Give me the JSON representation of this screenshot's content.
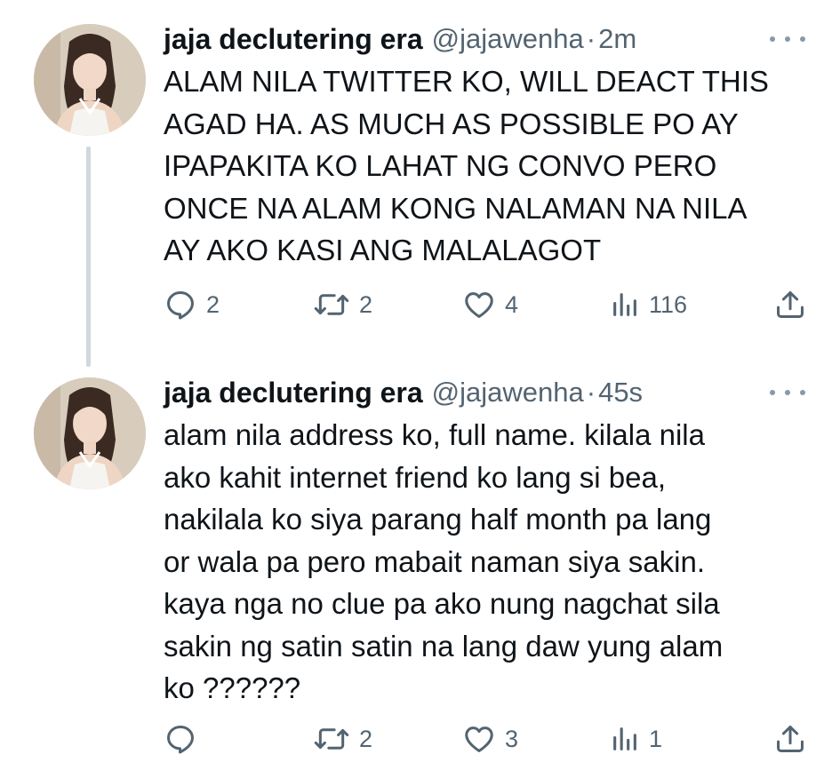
{
  "tweets": [
    {
      "name": "jaja declutering era",
      "handle": "@jajawenha",
      "separator": "·",
      "time": "2m",
      "lines": [
        "ALAM NILA TWITTER KO, WILL DEACT THIS",
        "AGAD HA. AS MUCH AS POSSIBLE PO AY",
        "IPAPAKITA KO LAHAT NG CONVO PERO",
        "ONCE NA ALAM KONG NALAMAN NA NILA",
        "AY AKO KASI ANG MALALAGOT"
      ],
      "replies": "2",
      "retweets": "2",
      "likes": "4",
      "views": "116"
    },
    {
      "name": "jaja declutering era",
      "handle": "@jajawenha",
      "separator": "·",
      "time": "45s",
      "lines": [
        "alam nila address ko, full name. kilala nila",
        "ako kahit internet friend ko lang si bea,",
        "nakilala ko siya parang half month pa lang",
        "or wala pa pero mabait naman siya sakin.",
        "kaya nga no clue pa ako nung nagchat sila",
        "sakin ng satin satin na lang daw yung alam",
        "ko ??????"
      ],
      "replies": "",
      "retweets": "2",
      "likes": "3",
      "views": "1"
    }
  ],
  "icons": {
    "reply": "reply-icon",
    "retweet": "retweet-icon",
    "like": "heart-icon",
    "views": "views-icon",
    "share": "share-icon",
    "more": "more-icon"
  },
  "colors": {
    "text": "#0f1419",
    "secondary": "#536471",
    "thread_line": "#cfd9de"
  }
}
